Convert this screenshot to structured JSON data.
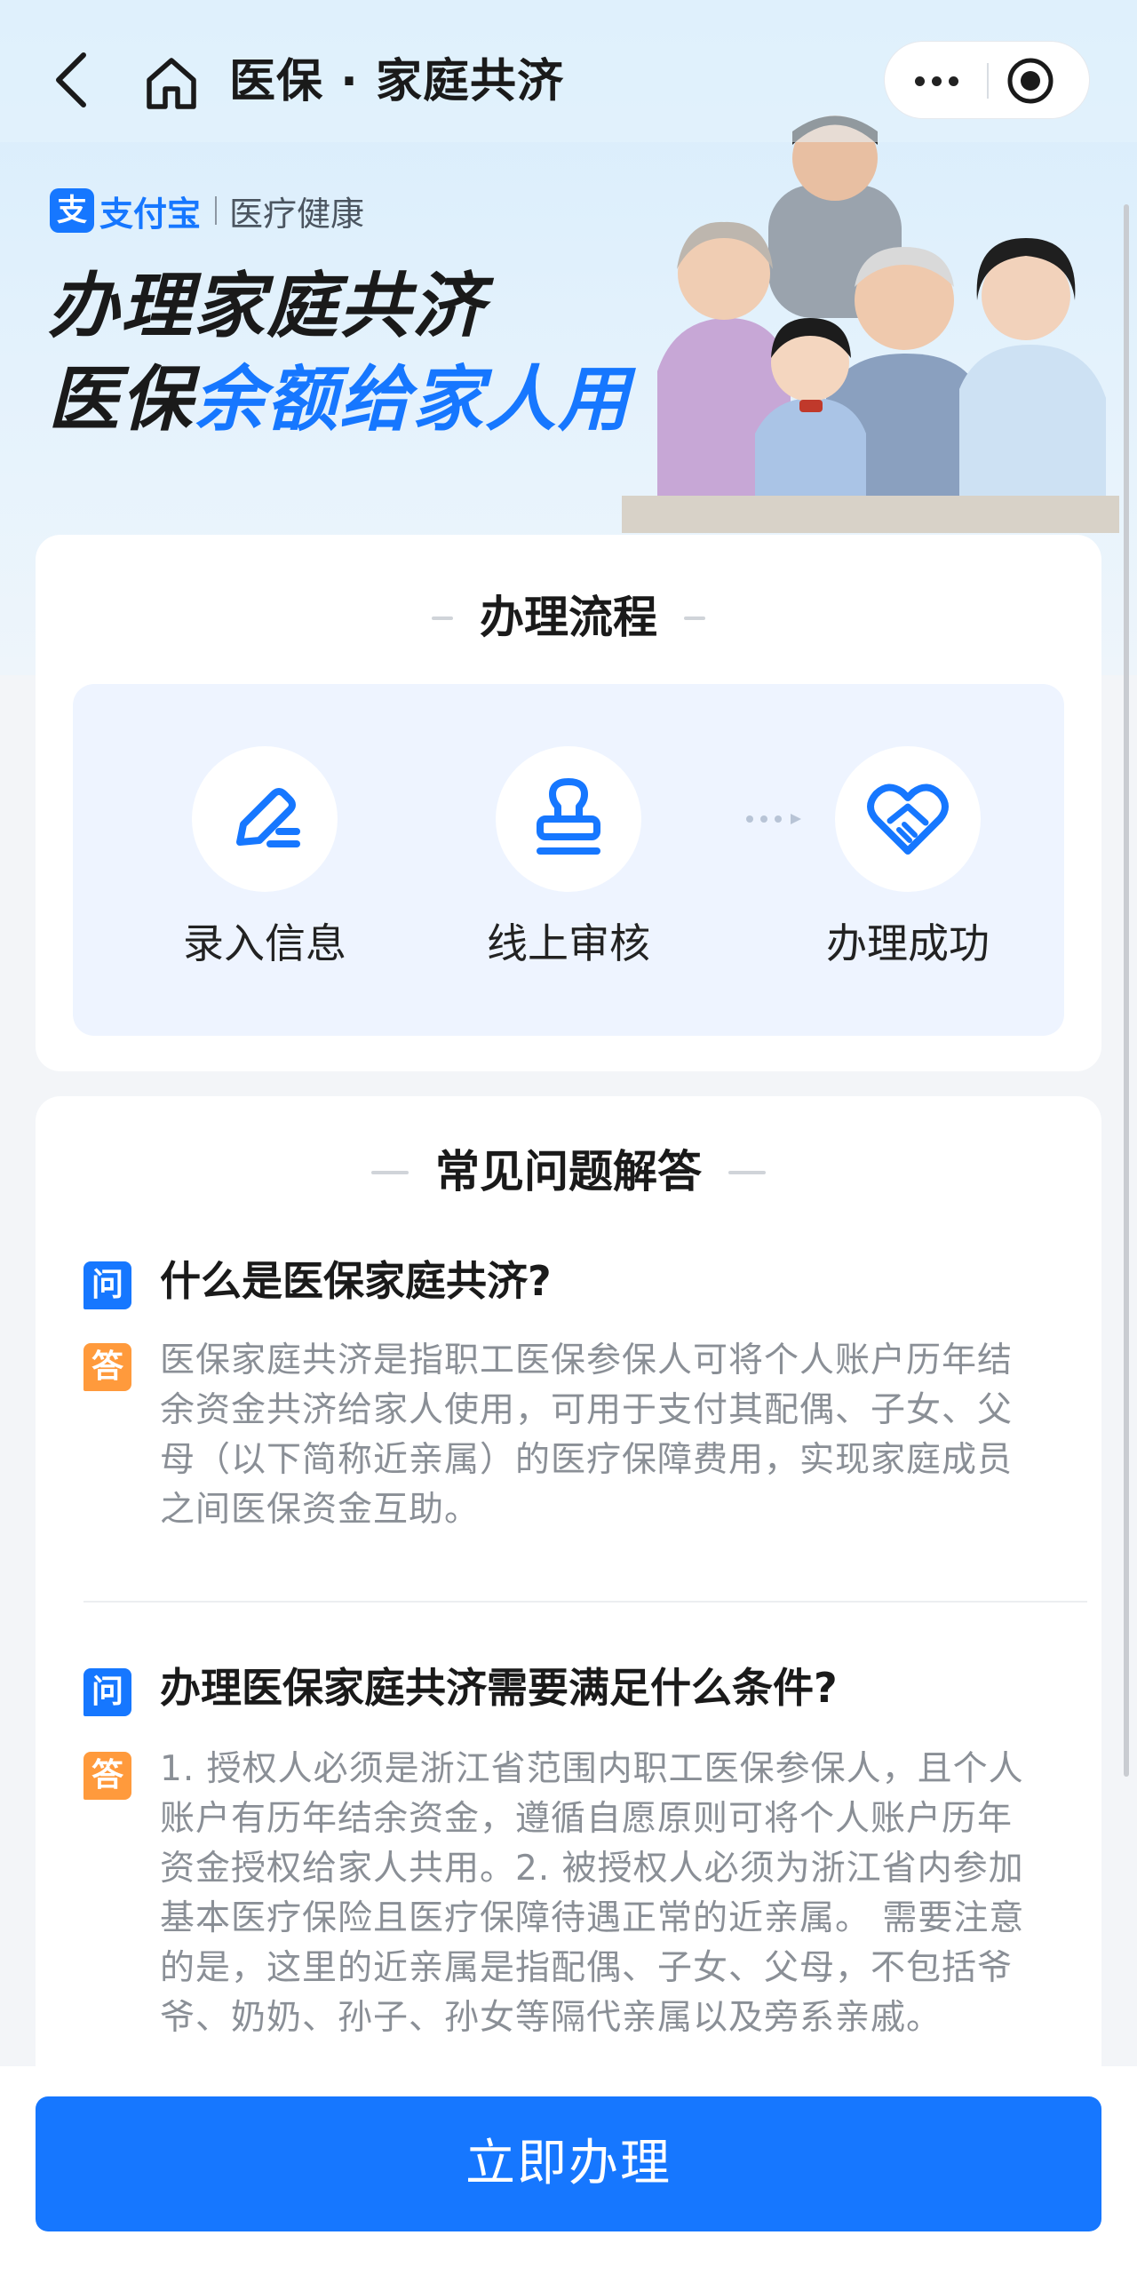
{
  "nav": {
    "title": "医保 · 家庭共济"
  },
  "hero": {
    "brand_name": "支付宝",
    "brand_sub": "医疗健康",
    "title_line1": "办理家庭共济",
    "title_line2_prefix": "医保",
    "title_line2_accent": "余额给家人用"
  },
  "process": {
    "title": "办理流程",
    "steps": [
      {
        "label": "录入信息",
        "icon": "edit-icon"
      },
      {
        "label": "线上审核",
        "icon": "stamp-icon"
      },
      {
        "label": "办理成功",
        "icon": "heart-handshake-icon"
      }
    ]
  },
  "faq": {
    "title": "常见问题解答",
    "q_badge": "问",
    "a_badge": "答",
    "items": [
      {
        "question": "什么是医保家庭共济?",
        "answer_lines": [
          "医保家庭共济是指职工医保参保人可将个人账户历年结",
          "余资金共济给家人使用，可用于支付其配偶、子女、父",
          "母（以下简称近亲属）的医疗保障费用，实现家庭成员",
          "之间医保资金互助。"
        ]
      },
      {
        "question": "办理医保家庭共济需要满足什么条件?",
        "answer_lines": [
          "1. 授权人必须是浙江省范围内职工医保参保人，且个人",
          "账户有历年结余资金，遵循自愿原则可将个人账户历年",
          "资金授权给家人共用。2. 被授权人必须为浙江省内参加",
          "基本医疗保险且医疗保障待遇正常的近亲属。 需要注意",
          "的是，这里的近亲属是指配偶、子女、父母，不包括爷",
          "爷、奶奶、孙子、孙女等隔代亲属以及旁系亲戚。"
        ]
      }
    ]
  },
  "cta": {
    "label": "立即办理"
  },
  "colors": {
    "primary": "#1677ff",
    "answer_badge": "#ff9a3c"
  }
}
